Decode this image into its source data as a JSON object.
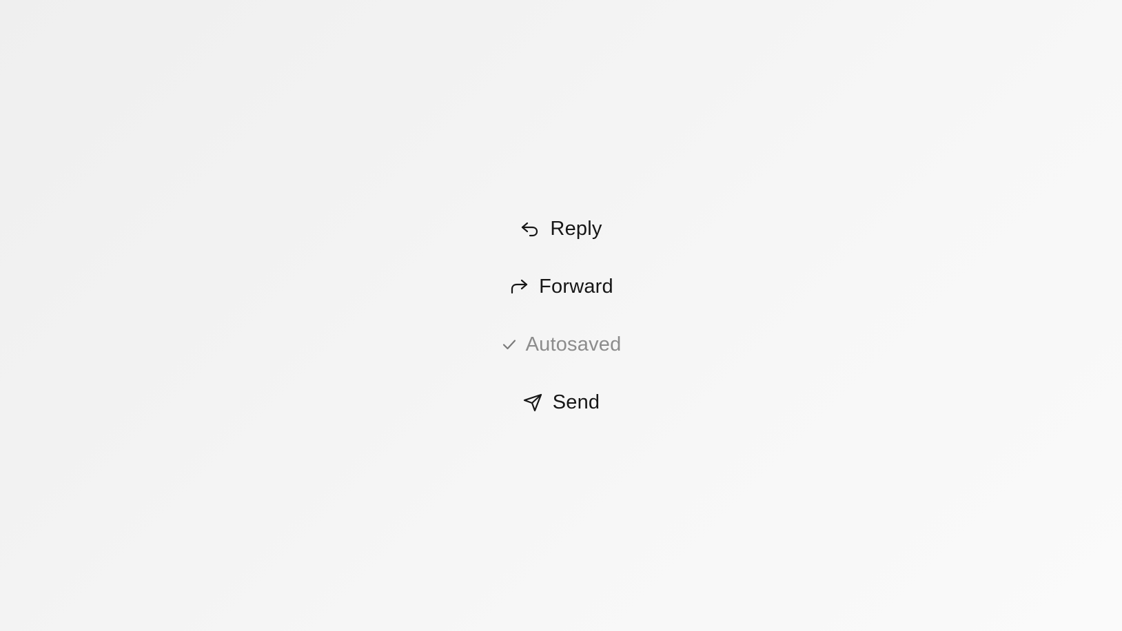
{
  "actions": {
    "reply": {
      "label": "Reply",
      "icon": "reply-arrow-icon"
    },
    "forward": {
      "label": "Forward",
      "icon": "forward-arrow-icon"
    },
    "autosaved": {
      "label": "Autosaved",
      "icon": "check-icon"
    },
    "send": {
      "label": "Send",
      "icon": "paper-plane-icon"
    }
  },
  "colors": {
    "text": "#161616",
    "muted_text": "#8c8c8c",
    "background": "#f3f3f3"
  }
}
